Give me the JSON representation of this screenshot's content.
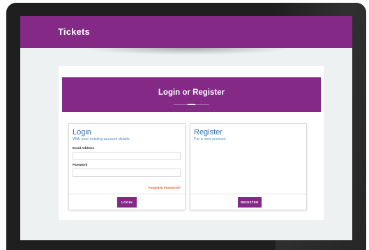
{
  "app": {
    "title": "Tickets"
  },
  "banner": {
    "title": "Login or Register"
  },
  "login": {
    "title": "Login",
    "subtitle": "With your existing account details",
    "email_label": "Email Address",
    "email_value": "",
    "password_label": "Password",
    "password_value": "",
    "forgot_label": "Forgotten Password?",
    "button_label": "LOGIN"
  },
  "register": {
    "title": "Register",
    "subtitle": "For a new account",
    "button_label": "REGISTER"
  },
  "colors": {
    "brand_purple": "#852987",
    "heading_blue": "#2f6fa8",
    "link_orange": "#e4572e"
  }
}
